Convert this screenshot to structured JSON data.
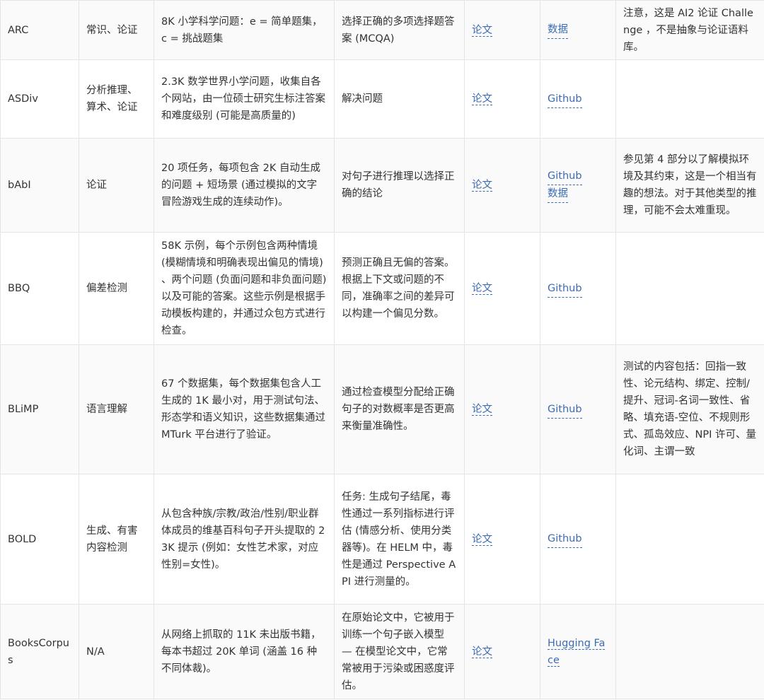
{
  "rows": [
    {
      "name": "ARC",
      "skill": "常识、论证",
      "contents": "8K 小学科学问题：e = 简单题集，c = 挑战题集",
      "task": "选择正确的多项选择题答案 (MCQA)",
      "paper": "论文",
      "links": [
        "数据"
      ],
      "notes": "注意，这是 AI2 论证 Challenge ，不是抽象与论证语料库。"
    },
    {
      "name": "ASDiv",
      "skill": "分析推理、算术、论证",
      "contents": "2.3K 数学世界小学问题，收集自各个网站，由一位硕士研究生标注答案和难度级别 (可能是高质量的)",
      "task": "解决问题",
      "paper": "论文",
      "links": [
        "Github"
      ],
      "notes": ""
    },
    {
      "name": "bAbI",
      "skill": "论证",
      "contents": "20 项任务，每项包含 2K 自动生成的问题 + 短场景 (通过模拟的文字冒险游戏生成的连续动作)。",
      "task": "对句子进行推理以选择正确的结论",
      "paper": "论文",
      "links": [
        "Github",
        "数据"
      ],
      "notes": "参见第 4 部分以了解模拟环境及其约束，这是一个相当有趣的想法。对于其他类型的推理，可能不会太难重现。"
    },
    {
      "name": "BBQ",
      "skill": "偏差检测",
      "contents": "58K 示例，每个示例包含两种情境 (模糊情境和明确表现出偏见的情境) 、两个问题 (负面问题和非负面问题) 以及可能的答案。这些示例是根据手动模板构建的，并通过众包方式进行检查。",
      "task": "预测正确且无偏的答案。根据上下文或问题的不同，准确率之间的差异可以构建一个偏见分数。",
      "paper": "论文",
      "links": [
        "Github"
      ],
      "notes": ""
    },
    {
      "name": "BLiMP",
      "skill": "语言理解",
      "contents": "67 个数据集，每个数据集包含人工生成的 1K 最小对，用于测试句法、形态学和语义知识，这些数据集通过 MTurk 平台进行了验证。",
      "task": "通过检查模型分配给正确句子的对数概率是否更高来衡量准确性。",
      "paper": "论文",
      "links": [
        "Github"
      ],
      "notes": "测试的内容包括：回指一致性、论元结构、绑定、控制/提升、冠词-名词一致性、省略、填充语-空位、不规则形式、孤岛效应、NPI 许可、量化词、主谓一致"
    },
    {
      "name": "BOLD",
      "skill": "生成、有害内容检测",
      "contents": "从包含种族/宗教/政治/性别/职业群体成员的维基百科句子开头提取的 23K 提示 (例如：女性艺术家，对应性别=女性)。",
      "task": "任务: 生成句子结尾，毒性通过一系列指标进行评估 (情感分析、使用分类器等)。在 HELM 中，毒性是通过 Perspective API 进行测量的。",
      "paper": "论文",
      "links": [
        "Github"
      ],
      "notes": ""
    },
    {
      "name": "BooksCorpus",
      "skill": "N/A",
      "contents": "从网络上抓取的 11K 未出版书籍，每本书超过 20K 单词 (涵盖 16 种不同体裁)。",
      "task": "在原始论文中，它被用于训练一个句子嵌入模型 — 在模型论文中，它常常被用于污染或困惑度评估。",
      "paper": "论文",
      "links": [
        "Hugging Face"
      ],
      "notes": ""
    }
  ]
}
